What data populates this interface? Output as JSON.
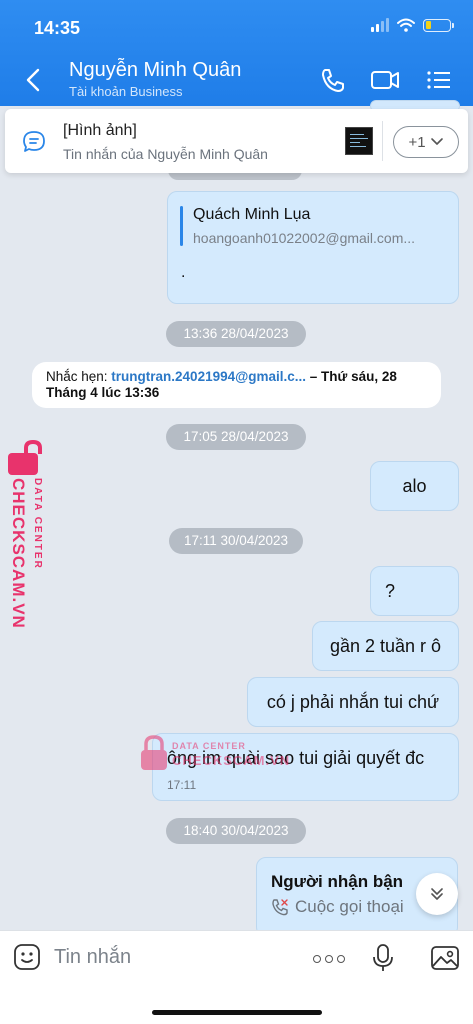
{
  "status": {
    "time": "14:35"
  },
  "header": {
    "name": "Nguyễn Minh Quân",
    "subtitle": "Tài khoản Business"
  },
  "pinned": {
    "title": "[Hình ảnh]",
    "subtitle": "Tin nhắn của Nguyễn Minh Quân",
    "more": "+1"
  },
  "messages": {
    "quote": {
      "author": "Quách Minh Lụa",
      "email": "hoangoanh01022002@gmail.com...",
      "body": "."
    },
    "time1": "13:36 28/04/2023",
    "reminder": {
      "prefix": "Nhắc hẹn: ",
      "link": "trungtran.24021994@gmail.c...",
      "suffix": " – Thứ sáu, 28 Tháng 4 lúc 13:36"
    },
    "time2": "17:05 28/04/2023",
    "m_alo": "alo",
    "time3": "17:11 30/04/2023",
    "m_q": "?",
    "m_2tuan": "gần 2 tuần r ô",
    "m_coj": "có j phải nhắn tui chứ",
    "m_ongim": "ông im quài sao tui giải quyết đc",
    "m_ongim_time": "17:11",
    "time4": "18:40 30/04/2023",
    "call": {
      "title": "Người nhận bận",
      "subtitle": "Cuộc gọi thoại"
    }
  },
  "watermark": {
    "brand": "CHECKSCAM.VN",
    "tag": "DATA CENTER"
  },
  "composer": {
    "placeholder": "Tin nhắn"
  },
  "colors": {
    "header": "#2f8df1",
    "bubble": "#d4eafd",
    "accent": "#2a86e8",
    "watermark": "#e8336c"
  },
  "icons": [
    "back-icon",
    "phone-icon",
    "video-call-icon",
    "menu-icon",
    "chat-bubble-icon",
    "chevron-down-icon",
    "emoji-icon",
    "more-icon",
    "mic-icon",
    "image-icon",
    "lock-icon"
  ]
}
